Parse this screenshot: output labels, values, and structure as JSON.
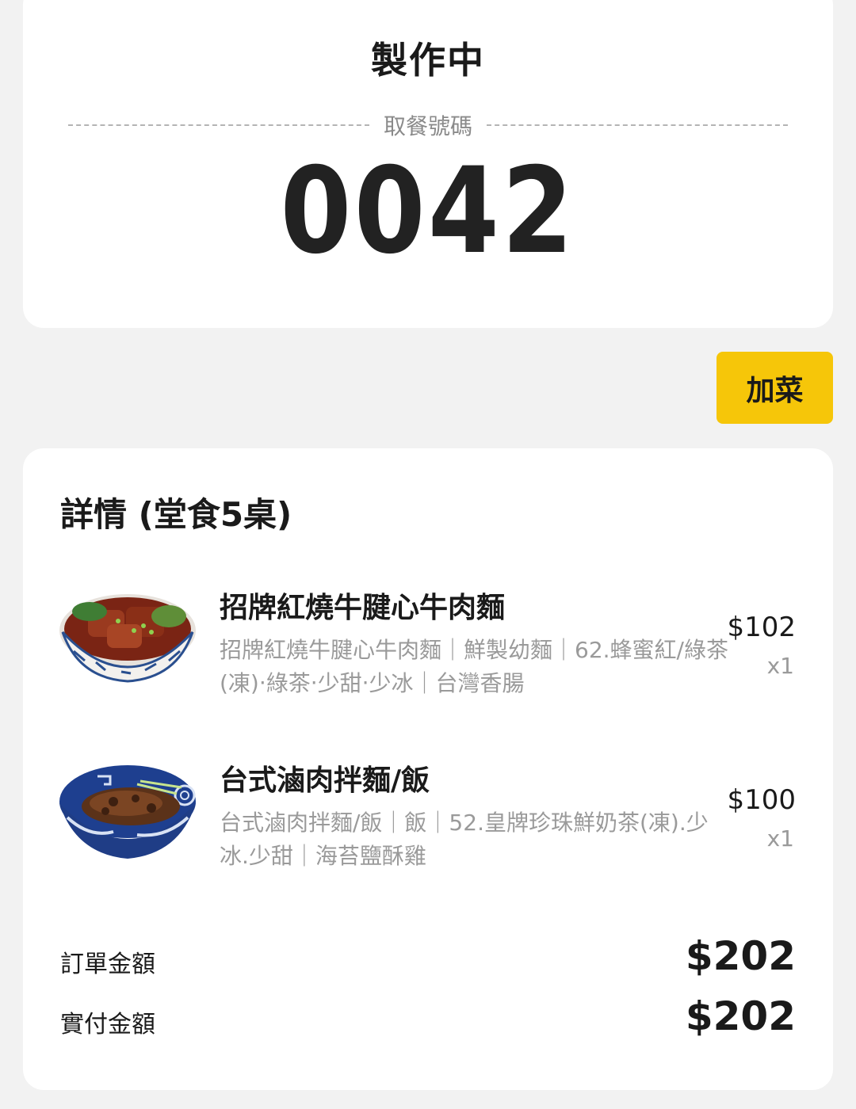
{
  "status": {
    "title": "製作中",
    "pickup_label": "取餐號碼",
    "pickup_number": "0042"
  },
  "actions": {
    "add_dishes_label": "加菜"
  },
  "details": {
    "title": "詳情 (堂食5桌)",
    "items": [
      {
        "name": "招牌紅燒牛腱心牛肉麵",
        "description": "招牌紅燒牛腱心牛肉麵｜鮮製幼麵｜62.蜂蜜紅/綠茶 (凍)‧綠茶‧少甜‧少冰｜台灣香腸",
        "price": "$102",
        "quantity": "x1",
        "image_icon": "beef-noodle-bowl"
      },
      {
        "name": "台式滷肉拌麵/飯",
        "description": "台式滷肉拌麵/飯｜飯｜52.皇牌珍珠鮮奶茶(凍).少冰.少甜｜海苔鹽酥雞",
        "price": "$100",
        "quantity": "x1",
        "image_icon": "braised-pork-rice-bowl"
      }
    ]
  },
  "totals": {
    "order_amount_label": "訂單金額",
    "order_amount_value": "$202",
    "paid_amount_label": "實付金額",
    "paid_amount_value": "$202"
  },
  "colors": {
    "background": "#f2f2f2",
    "card": "#ffffff",
    "accent_yellow": "#f6c609",
    "text_primary": "#1a1a1a",
    "text_secondary": "#9a9a9a"
  }
}
